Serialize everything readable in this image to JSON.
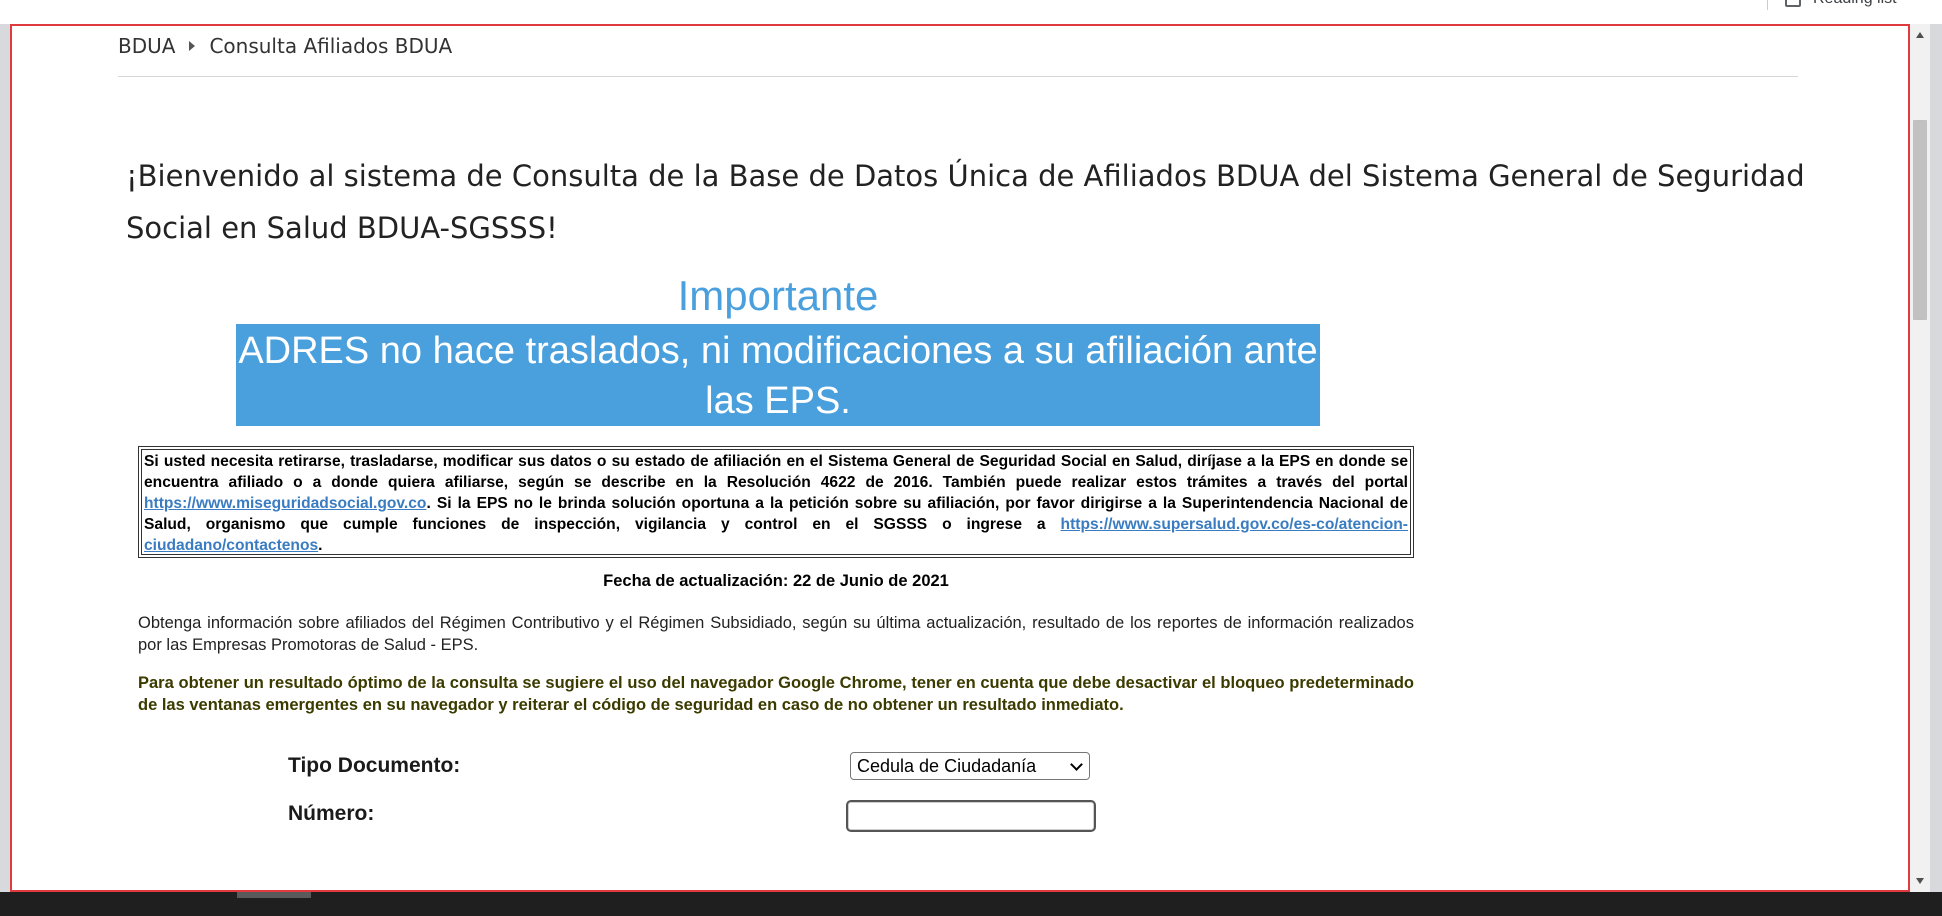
{
  "bookmarks": {
    "reading_list": "Reading list"
  },
  "breadcrumb": {
    "root": "BDUA",
    "current": "Consulta Afiliados BDUA"
  },
  "welcome": {
    "title": "¡Bienvenido al sistema de Consulta de la Base de Datos Única de Afiliados BDUA del Sistema General de Seguridad Social en Salud BDUA-SGSSS!"
  },
  "importante": {
    "heading": "Importante",
    "banner": "ADRES no hace traslados, ni modificaciones a su afiliación ante las EPS."
  },
  "notice": {
    "text_1": "Si usted necesita retirarse, trasladarse, modificar sus datos o su estado de afiliación en el Sistema General de Seguridad Social en Salud, diríjase a la EPS en donde se encuentra afiliado o a donde quiera afiliarse, según se describe en la Resolución 4622 de 2016. También puede realizar estos trámites a través del portal ",
    "link_1": "https://www.miseguridadsocial.gov.co",
    "text_2": ". Si la EPS no le brinda solución oportuna a la petición sobre su afiliación, por favor dirigirse a la Superintendencia Nacional de Salud, organismo que cumple funciones de inspección, vigilancia y control en el SGSSS o ingrese a ",
    "link_2": "https://www.supersalud.gov.co/es-co/atencion-ciudadano/contactenos",
    "text_3": "."
  },
  "fecha": "Fecha de actualización: 22 de Junio de 2021",
  "info_paragraph": "Obtenga información sobre afiliados del Régimen Contributivo y el Régimen Subsidiado, según su última actualización, resultado de los reportes de información realizados por las Empresas Promotoras de Salud - EPS.",
  "browser_tip": "Para obtener un resultado óptimo de la consulta se sugiere el uso del navegador Google Chrome, tener en cuenta que debe desactivar el bloqueo predeterminado de las ventanas emergentes en su navegador y reiterar el código de seguridad en caso de no obtener un resultado inmediato.",
  "form": {
    "tipo_documento_label": "Tipo Documento:",
    "tipo_documento_selected": "Cedula de Ciudadanía",
    "numero_label": "Número:",
    "numero_value": "",
    "numero_placeholder": ""
  },
  "colors": {
    "accent_blue": "#4a9fdd",
    "link_blue": "#3a7cc1",
    "focus_border_red": "#e0393e",
    "tip_text": "#3b3b00"
  }
}
